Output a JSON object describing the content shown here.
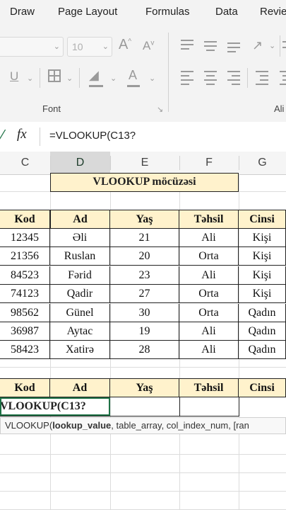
{
  "ribbon_tabs": [
    "Draw",
    "Page Layout",
    "Formulas",
    "Data",
    "Revie"
  ],
  "ribbon": {
    "font_size": "10",
    "grow_font": "A",
    "shrink_font": "A",
    "underline": "U",
    "font_color": "A",
    "font_group_label": "Font",
    "alignment_group_label": "Ali"
  },
  "formula_bar": {
    "fx_label": "fx",
    "formula": "=VLOOKUP(C13?"
  },
  "columns": [
    "C",
    "D",
    "E",
    "F",
    "G"
  ],
  "selected_column": "D",
  "sheet": {
    "title": "VLOOKUP möcüzəsi",
    "headers": [
      "Kod",
      "Ad",
      "Yaş",
      "Təhsil",
      "Cinsi"
    ],
    "rows": [
      [
        "12345",
        "Əli",
        "21",
        "Ali",
        "Kişi"
      ],
      [
        "21356",
        "Ruslan",
        "20",
        "Orta",
        "Kişi"
      ],
      [
        "84523",
        "Fərid",
        "23",
        "Ali",
        "Kişi"
      ],
      [
        "74123",
        "Qadir",
        "27",
        "Orta",
        "Kişi"
      ],
      [
        "98562",
        "Günel",
        "30",
        "Orta",
        "Qadın"
      ],
      [
        "36987",
        "Aytac",
        "19",
        "Ali",
        "Qadın"
      ],
      [
        "58423",
        "Xatirə",
        "28",
        "Ali",
        "Qadın"
      ]
    ],
    "lookup_headers": [
      "Kod",
      "Ad",
      "Yaş",
      "Təhsil",
      "Cinsi"
    ],
    "editing_cell_text": "VLOOKUP(C13?",
    "tooltip": {
      "func": "VLOOKUP(",
      "bold_arg": "lookup_value",
      "rest": ", table_array, col_index_num, [ran"
    }
  },
  "colors": {
    "header_fill": "#fff2cc",
    "selected_col_fill": "#d9d9d9",
    "excel_green": "#1e7145"
  }
}
